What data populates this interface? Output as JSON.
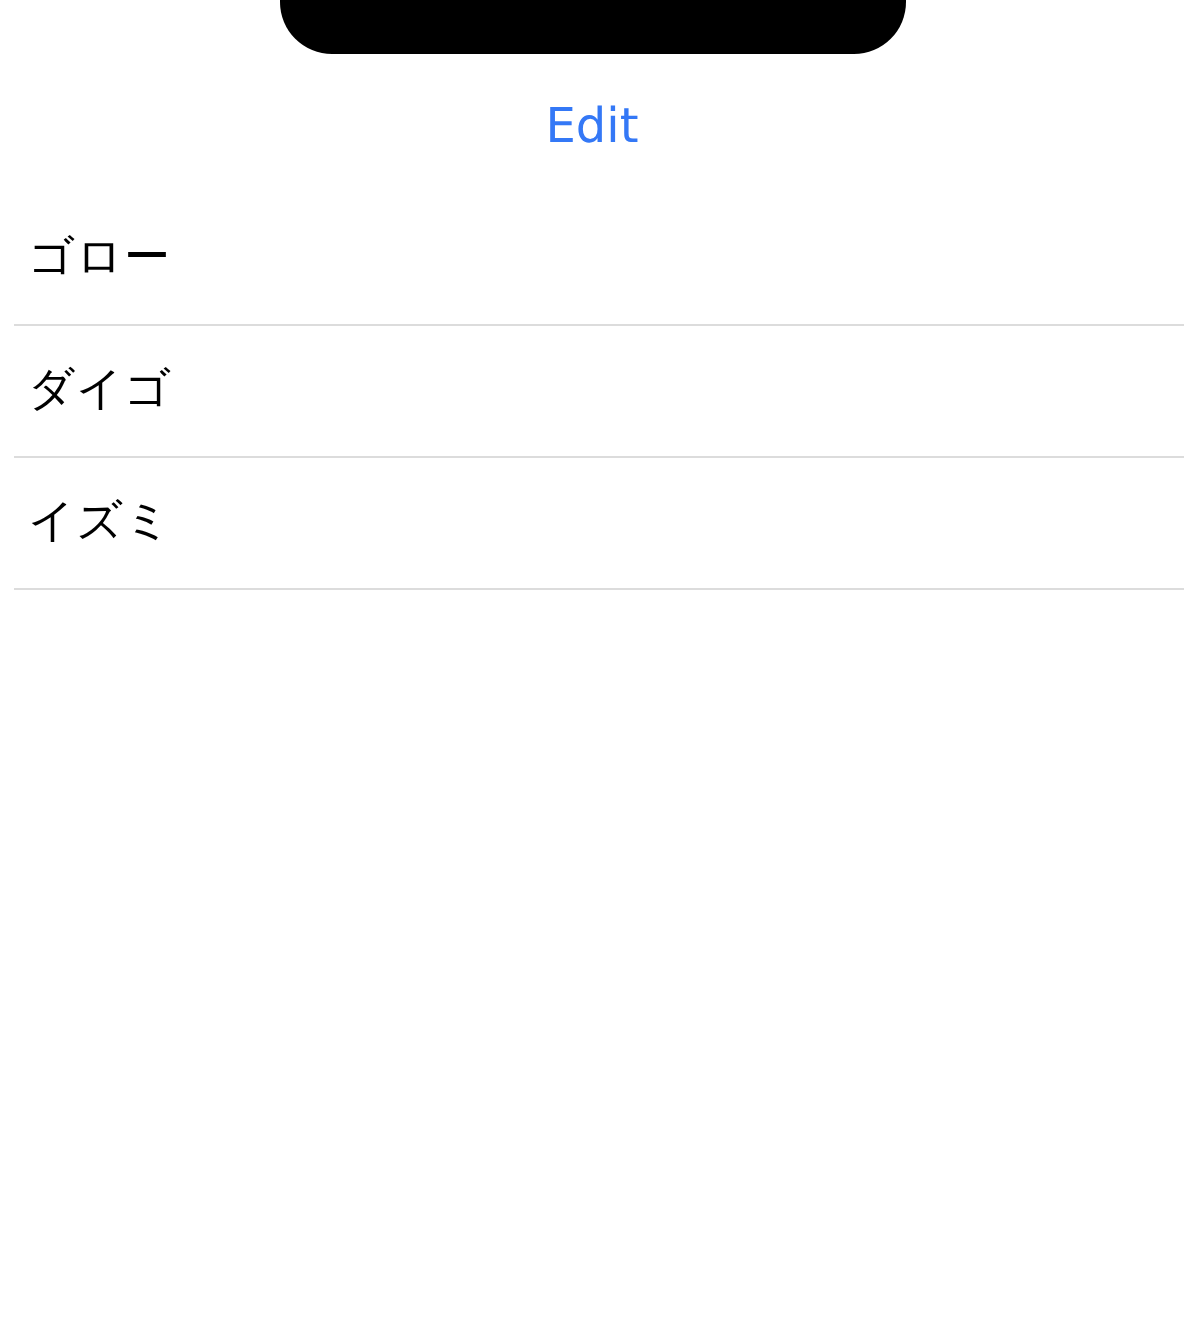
{
  "nav": {
    "edit_button": "Edit"
  },
  "list": [
    {
      "name": "ゴロー"
    },
    {
      "name": "ダイゴ"
    },
    {
      "name": "イズミ"
    }
  ]
}
